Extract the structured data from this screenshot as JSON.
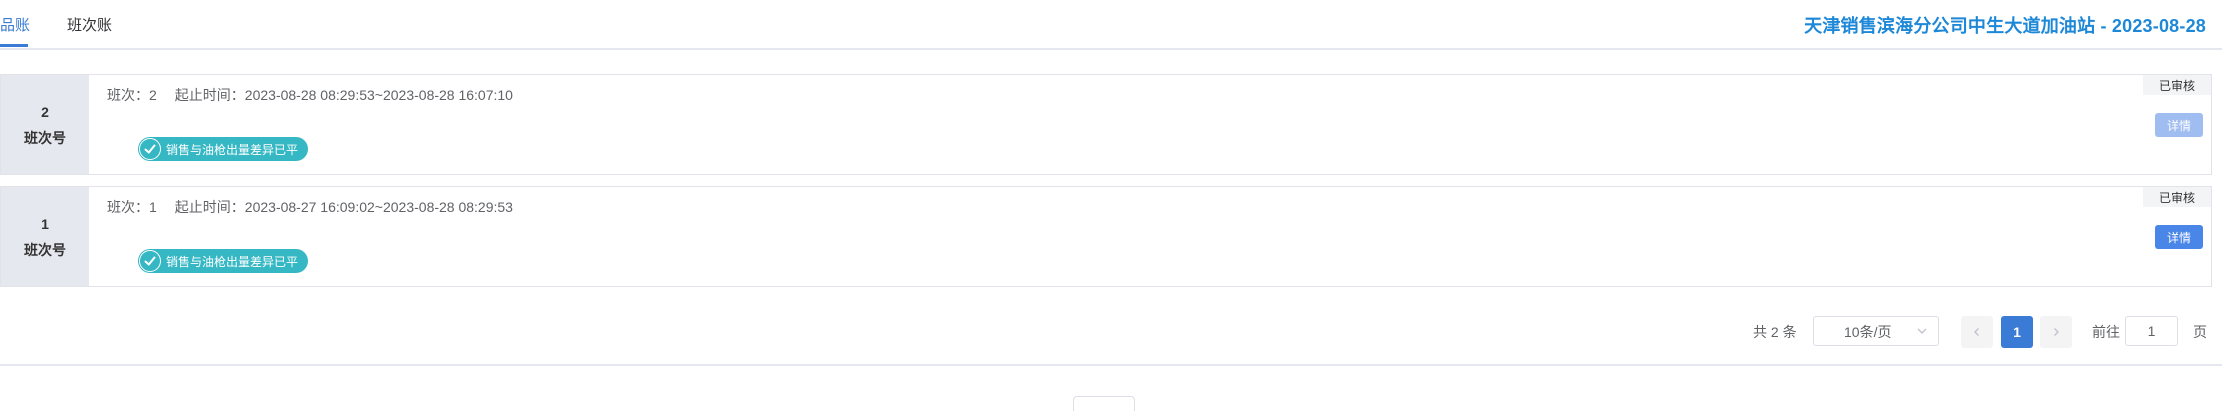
{
  "tabs": [
    {
      "label": "品账",
      "active": true
    },
    {
      "label": "班次账",
      "active": false
    }
  ],
  "station_title": "天津销售滨海分公司中生大道加油站 - 2023-08-28",
  "shifts": [
    {
      "number": "2",
      "number_label": "班次号",
      "shift_text": "班次：2",
      "time_text": "起止时间：2023-08-28 08:29:53~2023-08-28 16:07:10",
      "badge": "销售与油枪出量差异已平",
      "status": "已审核",
      "detail_label": "详情",
      "detail_enabled": false
    },
    {
      "number": "1",
      "number_label": "班次号",
      "shift_text": "班次：1",
      "time_text": "起止时间：2023-08-27 16:09:02~2023-08-28 08:29:53",
      "badge": "销售与油枪出量差异已平",
      "status": "已审核",
      "detail_label": "详情",
      "detail_enabled": true
    }
  ],
  "pagination": {
    "total_text": "共 2 条",
    "page_size": "10条/页",
    "current_page": "1",
    "goto_label": "前往",
    "goto_value": "1",
    "goto_suffix": "页"
  },
  "colors": {
    "accent": "#3a7bd5",
    "title": "#1e88d8",
    "badge": "#35b8c4",
    "side_panel": "#e5e8ee"
  },
  "icons": {
    "check": "check-icon",
    "chevron_down": "chevron-down-icon",
    "chevron_left": "chevron-left-icon",
    "chevron_right": "chevron-right-icon"
  }
}
